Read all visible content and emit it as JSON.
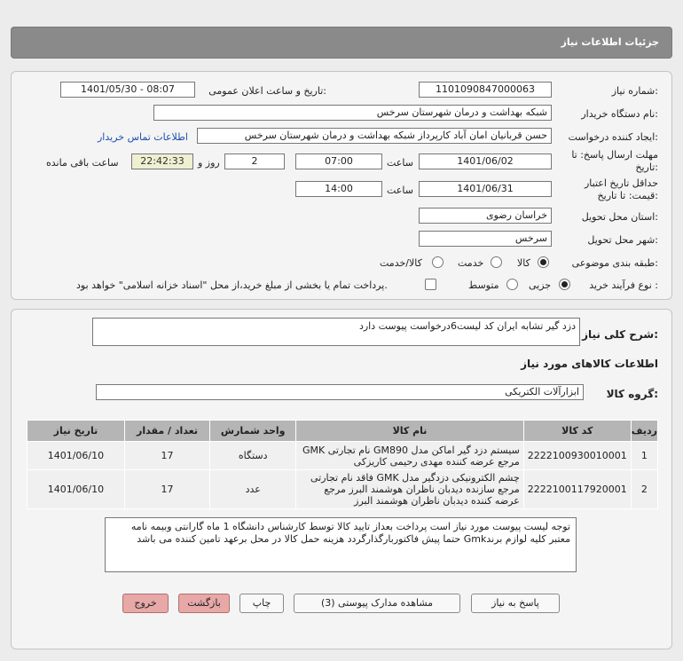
{
  "header": {
    "title": "جزئیات اطلاعات نیاز"
  },
  "form": {
    "need_number_label": "شماره نیاز:",
    "need_number": "1101090847000063",
    "announce_label": "تاریخ و ساعت اعلان عمومی:",
    "announce_value": "1401/05/30 - 08:07",
    "buyer_label": "نام دستگاه خریدار:",
    "buyer_value": "شبکه بهداشت و درمان شهرستان سرخس",
    "creator_label": "ایجاد کننده درخواست:",
    "creator_value": "حسن قربانیان امان آباد کارپرداز شبکه بهداشت و درمان شهرستان سرخس",
    "contact_link": "اطلاعات تماس خریدار",
    "deadline_label_1": "مهلت ارسال پاسخ: تا",
    "deadline_label_2": "تاریخ:",
    "deadline_date": "1401/06/02",
    "time_label": "ساعت",
    "deadline_time": "07:00",
    "days_value": "2",
    "days_label": "روز و",
    "remaining_time": "22:42:33",
    "remaining_label": "ساعت باقی مانده",
    "validity_label_1": "حداقل تاریخ اعتبار",
    "validity_label_2": "قیمت: تا تاریخ:",
    "validity_date": "1401/06/31",
    "validity_time": "14:00",
    "province_label": "استان محل تحویل:",
    "province_value": "خراسان رضوی",
    "city_label": "شهر محل تحویل:",
    "city_value": "سرخس",
    "category_label": "طبقه بندی موضوعی:",
    "category_options": [
      "کالا",
      "خدمت",
      "کالا/خدمت"
    ],
    "process_label": "نوع فرآیند خرید :",
    "process_options": [
      "جزیی",
      "متوسط"
    ],
    "payment_note": "پرداخت تمام یا بخشی از مبلغ خرید،از محل \"اسناد خزانه اسلامی\" خواهد بود."
  },
  "details": {
    "summary_label": "شرح کلی نیاز:",
    "summary_value": "دزد گیر تشابه ایران کد لیست6درخواست  پیوست دارد",
    "goods_info_title": "اطلاعات کالاهای مورد نیاز",
    "group_label": "گروه کالا:",
    "group_value": "ابزارآلات الکتریکی"
  },
  "table": {
    "headers": [
      "ردیف",
      "کد کالا",
      "نام کالا",
      "واحد شمارش",
      "تعداد / مقدار",
      "تاریخ نیاز"
    ],
    "rows": [
      {
        "row": "1",
        "code": "2222100930010001",
        "name": "سیستم دزد گیر اماکن مدل GM890 نام تجارتی GMK مرجع عرضه کننده مهدی رحیمی کاریزکی",
        "unit": "دستگاه",
        "qty": "17",
        "date": "1401/06/10"
      },
      {
        "row": "2",
        "code": "2222100117920001",
        "name": "چشم الکترونیکی دزدگیر مدل GMK فاقد نام تجارتی مرجع سازنده دیدبان ناظران هوشمند البرز مرجع عرضه کننده دیدبان ناظران هوشمند البرز",
        "unit": "عدد",
        "qty": "17",
        "date": "1401/06/10"
      }
    ]
  },
  "note": "توجه لیست پیوست مورد نیاز است پرداخت بعداز تایید کالا توسط کارشناس دانشگاه 1 ماه  گارانتی وبیمه نامه معتبر کلیه لوازم برندGmk حتما پیش فاکتوربارگذارگردد هزینه حمل کالا در محل برعهد تامین کننده می باشد",
  "buttons": {
    "reply": "پاسخ به نیاز",
    "attachments": "مشاهده مدارک پیوستی (3)",
    "print": "چاپ",
    "back": "بازگشت",
    "exit": "خروج"
  }
}
